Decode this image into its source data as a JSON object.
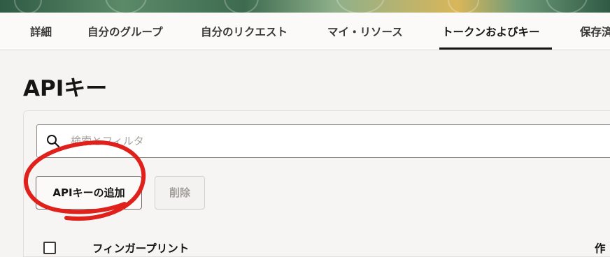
{
  "tabs": [
    {
      "label": "詳細"
    },
    {
      "label": "自分のグループ"
    },
    {
      "label": "自分のリクエスト"
    },
    {
      "label": "マイ・リソース"
    },
    {
      "label": "トークンおよびキー",
      "active": true
    },
    {
      "label": "保存済"
    }
  ],
  "page": {
    "title": "APIキー"
  },
  "search": {
    "placeholder": "検索とフィルタ",
    "icon": "search-icon"
  },
  "actions": {
    "add_label": "APIキーの追加",
    "delete_label": "削除"
  },
  "table": {
    "columns": [
      "フィンガープリント",
      "作"
    ]
  },
  "colors": {
    "annotation": "#e0201a",
    "active_tab_underline": "#161513"
  }
}
